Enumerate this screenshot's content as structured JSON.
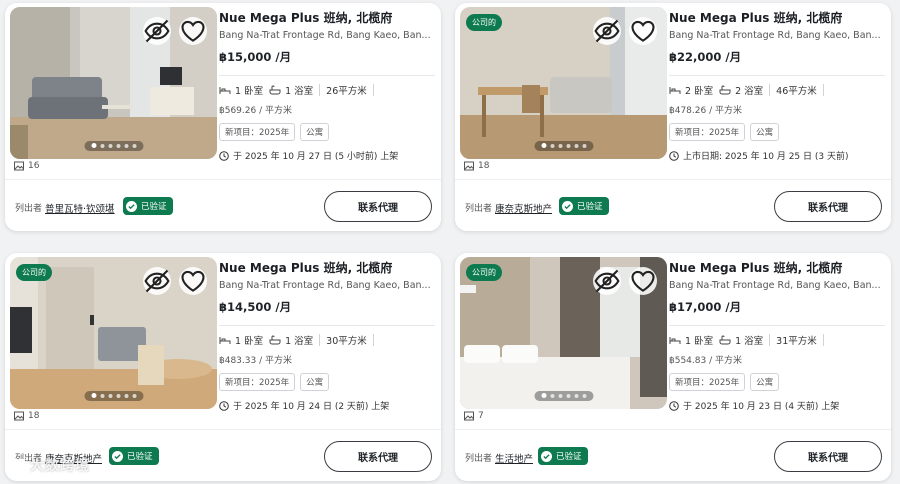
{
  "colors": {
    "accent": "#0e7a4f",
    "border": "#cfd2d6",
    "text": "#1f2328"
  },
  "icons": {
    "hide": "eye-off-icon",
    "favorite": "heart-icon",
    "bed": "bed-icon",
    "bath": "bath-icon",
    "photos": "image-icon",
    "clock": "clock-icon",
    "verified": "check-icon"
  },
  "listings": [
    {
      "badge": "",
      "title": "Nue Mega Plus 班纳, 北榄府",
      "address": "Bang Na-Trat Frontage Rd, Bang Kaeo, Ban...",
      "price": "฿15,000 /月",
      "bedrooms": "1 卧室",
      "bathrooms": "1 浴室",
      "area": "26平方米",
      "price_per_sqm": "฿569.26 / 平方米",
      "tags": [
        "新项目：2025年",
        "公寓"
      ],
      "listed": "于 2025 年 10 月 27 日 (5 小时前) 上架",
      "photo_count": "16",
      "lister_label": "列出者",
      "lister_name": "普里瓦特·钦颂堪",
      "verified": "已验证",
      "contact": "联系代理"
    },
    {
      "badge": "公司的",
      "title": "Nue Mega Plus 班纳, 北榄府",
      "address": "Bang Na-Trat Frontage Rd, Bang Kaeo, Ban...",
      "price": "฿22,000 /月",
      "bedrooms": "2 卧室",
      "bathrooms": "2 浴室",
      "area": "46平方米",
      "price_per_sqm": "฿478.26 / 平方米",
      "tags": [
        "新项目：2025年",
        "公寓"
      ],
      "listed": "上市日期: 2025 年 10 月 25 日 (3 天前)",
      "photo_count": "18",
      "lister_label": "列出者",
      "lister_name": "康奈克斯地产",
      "verified": "已验证",
      "contact": "联系代理"
    },
    {
      "badge": "公司的",
      "title": "Nue Mega Plus 班纳, 北榄府",
      "address": "Bang Na-Trat Frontage Rd, Bang Kaeo, Ban...",
      "price": "฿14,500 /月",
      "bedrooms": "1 卧室",
      "bathrooms": "1 浴室",
      "area": "30平方米",
      "price_per_sqm": "฿483.33 / 平方米",
      "tags": [
        "新项目：2025年",
        "公寓"
      ],
      "listed": "于 2025 年 10 月 24 日 (2 天前) 上架",
      "photo_count": "18",
      "lister_label": "列出者",
      "lister_name": "康奈克斯地产",
      "verified": "已验证",
      "contact": "联系代理"
    },
    {
      "badge": "公司的",
      "title": "Nue Mega Plus 班纳, 北榄府",
      "address": "Bang Na-Trat Frontage Rd, Bang Kaeo, Ban...",
      "price": "฿17,000 /月",
      "bedrooms": "1 卧室",
      "bathrooms": "1 浴室",
      "area": "31平方米",
      "price_per_sqm": "฿554.83 / 平方米",
      "tags": [
        "新项目：2025年",
        "公寓"
      ],
      "listed": "于 2025 年 10 月 23 日 (4 天前) 上架",
      "photo_count": "7",
      "lister_label": "列出者",
      "lister_name": "生活地产",
      "verified": "已验证",
      "contact": "联系代理"
    }
  ],
  "watermark": "大数跨境"
}
